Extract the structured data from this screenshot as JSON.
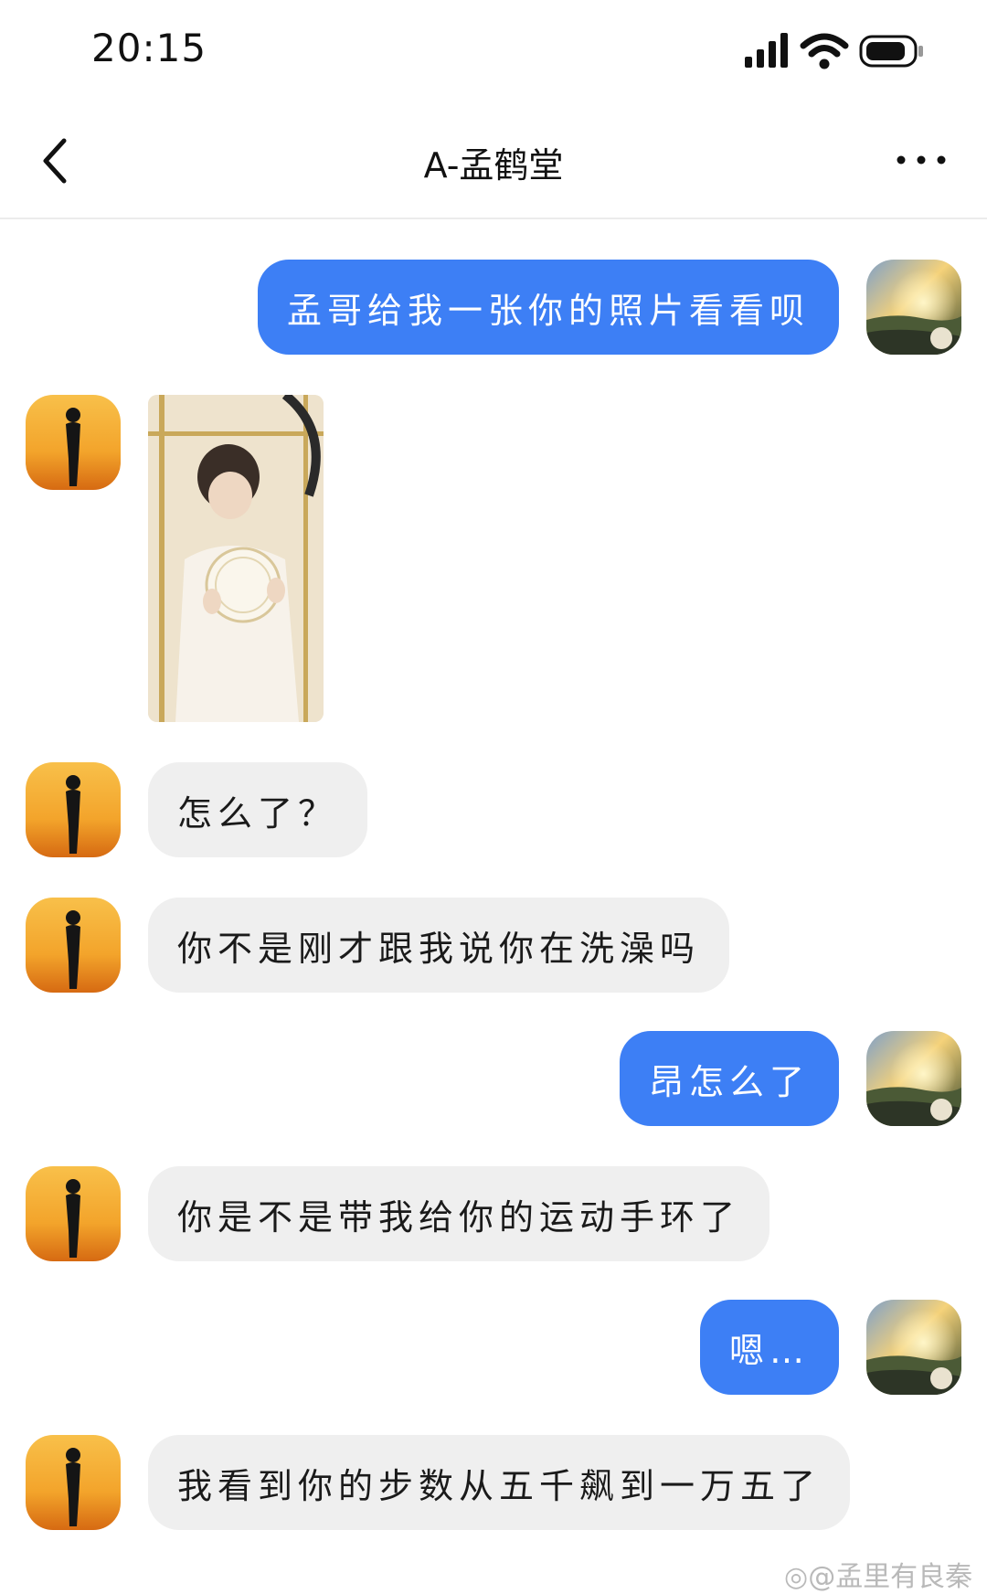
{
  "status_bar": {
    "time": "20:15"
  },
  "nav": {
    "title": "A-孟鹤堂"
  },
  "messages": [
    {
      "from": "me",
      "text": "孟哥给我一张你的照片看看呗"
    },
    {
      "from": "them",
      "type": "image"
    },
    {
      "from": "them",
      "text": "怎么了？"
    },
    {
      "from": "them",
      "text": "你不是刚才跟我说你在洗澡吗"
    },
    {
      "from": "me",
      "text": "昂怎么了"
    },
    {
      "from": "them",
      "text": "你是不是带我给你的运动手环了"
    },
    {
      "from": "me",
      "text": "嗯…"
    },
    {
      "from": "them",
      "text": "我看到你的步数从五千飙到一万五了"
    }
  ],
  "watermark": "@孟里有良秦",
  "colors": {
    "my_bubble": "#3d7ff5",
    "their_bubble": "#efefef"
  }
}
